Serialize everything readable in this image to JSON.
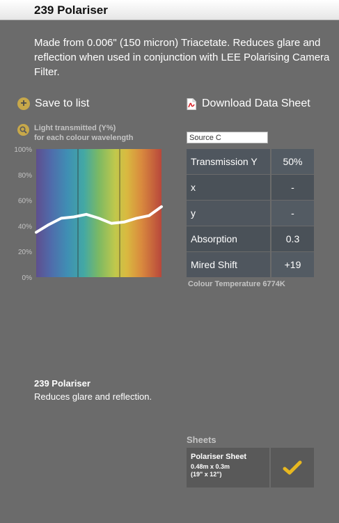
{
  "product": {
    "title": "239 Polariser",
    "description": "Made from 0.006\" (150 micron) Triacetate. Reduces glare and reflection when used in conjunction with LEE Polarising Camera Filter.",
    "summary_name": "239 Polariser",
    "summary_desc": "Reduces glare and reflection."
  },
  "actions": {
    "save": "Save to list",
    "download": "Download Data Sheet"
  },
  "graph": {
    "title_line1": "Light transmitted (Y%)",
    "title_line2": "for each colour wavelength"
  },
  "chart_data": {
    "type": "line",
    "x": [
      0,
      10,
      20,
      30,
      40,
      50,
      60,
      70,
      80,
      90,
      100
    ],
    "values": [
      35,
      41,
      46,
      47,
      49,
      46,
      42,
      43,
      46,
      48,
      55
    ],
    "yticks": [
      "100%",
      "80%",
      "60%",
      "40%",
      "20%",
      "0%"
    ],
    "ylim": [
      0,
      100
    ],
    "grid": "vertical lines at thirds"
  },
  "source": {
    "value": "Source C"
  },
  "specs": [
    {
      "label": "Transmission Y",
      "value": "50%"
    },
    {
      "label": "x",
      "value": "-"
    },
    {
      "label": "y",
      "value": "-"
    },
    {
      "label": "Absorption",
      "value": "0.3"
    },
    {
      "label": "Mired Shift",
      "value": "+19"
    }
  ],
  "colour_temperature": "Colour Temperature 6774K",
  "sheets": {
    "title": "Sheets",
    "items": [
      {
        "name": "Polariser Sheet",
        "size_metric": "0.48m x 0.3m",
        "size_imperial": "(19\" x 12\")"
      }
    ]
  },
  "colors": {
    "accent": "#c7a84a",
    "check": "#e8b820"
  }
}
